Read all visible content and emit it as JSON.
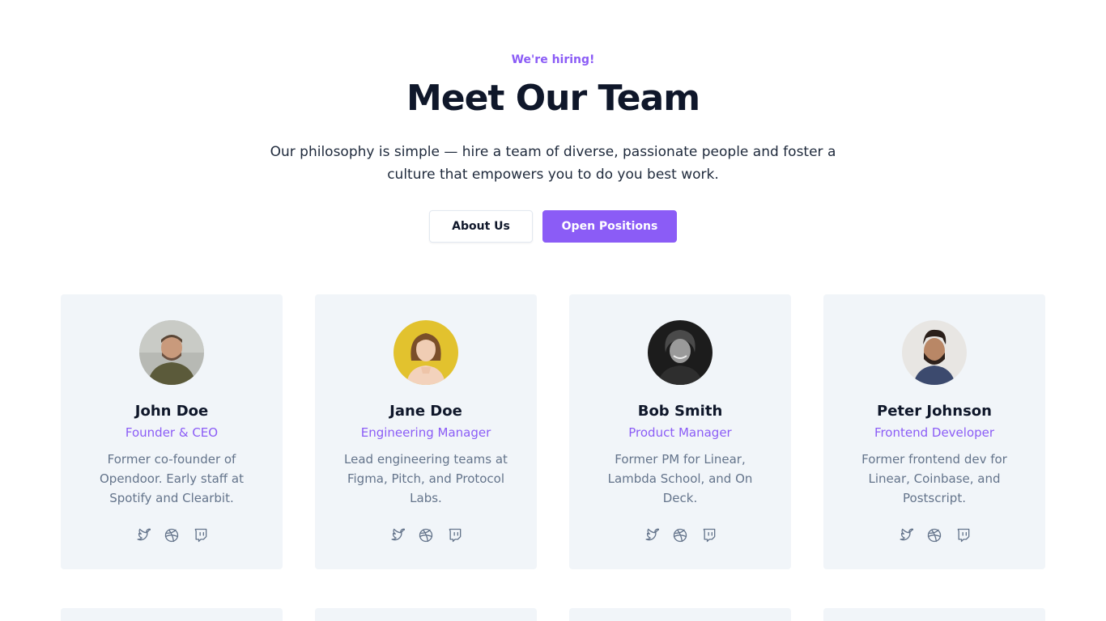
{
  "hero": {
    "eyebrow": "We're hiring!",
    "title": "Meet Our Team",
    "subtitle": "Our philosophy is simple — hire a team of diverse, passionate people and foster a culture that empowers you to do you best work.",
    "buttons": {
      "about": "About Us",
      "positions": "Open Positions"
    }
  },
  "colors": {
    "accent": "#8b5cf6",
    "card_bg": "#f1f5f9",
    "text_muted": "#64748b"
  },
  "team": [
    {
      "name": "John Doe",
      "role": "Founder & CEO",
      "bio": "Former co-founder of Opendoor. Early staff at Spotify and Clearbit.",
      "socials": [
        "twitter-icon",
        "dribbble-icon",
        "twitch-icon"
      ]
    },
    {
      "name": "Jane Doe",
      "role": "Engineering Manager",
      "bio": "Lead engineering teams at Figma, Pitch, and Protocol Labs.",
      "socials": [
        "twitter-icon",
        "dribbble-icon",
        "twitch-icon"
      ]
    },
    {
      "name": "Bob Smith",
      "role": "Product Manager",
      "bio": "Former PM for Linear, Lambda School, and On Deck.",
      "socials": [
        "twitter-icon",
        "dribbble-icon",
        "twitch-icon"
      ]
    },
    {
      "name": "Peter Johnson",
      "role": "Frontend Developer",
      "bio": "Former frontend dev for Linear, Coinbase, and Postscript.",
      "socials": [
        "twitter-icon",
        "dribbble-icon",
        "twitch-icon"
      ]
    }
  ]
}
